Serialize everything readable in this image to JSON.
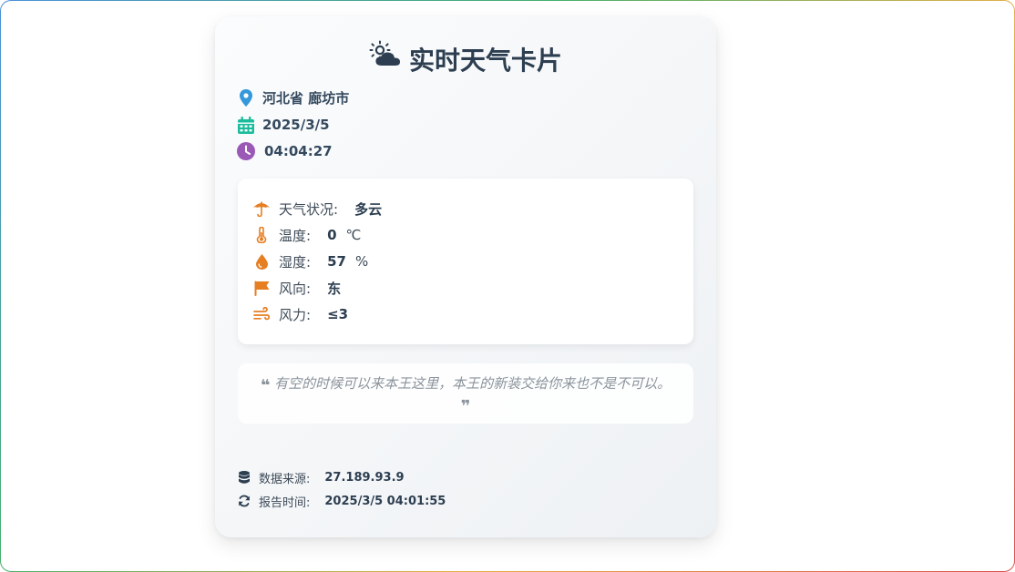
{
  "card": {
    "title": "实时天气卡片",
    "title_icon": "cloud-sun-icon"
  },
  "meta": {
    "location": "河北省 廊坊市",
    "date": "2025/3/5",
    "time": "04:04:27"
  },
  "weather": {
    "condition_label": "天气状况:",
    "condition_value": "多云",
    "temp_label": "温度:",
    "temp_value": "0",
    "temp_unit": "℃",
    "humidity_label": "湿度:",
    "humidity_value": "57",
    "humidity_unit": "%",
    "wind_dir_label": "风向:",
    "wind_dir_value": "东",
    "wind_power_label": "风力:",
    "wind_power_value": "≤3"
  },
  "quote": {
    "text": "有空的时候可以来本王这里，本王的新装交给你来也不是不可以。"
  },
  "footer": {
    "source_label": "数据来源:",
    "source_value": "27.189.93.9",
    "report_label": "报告时间:",
    "report_value": "2025/3/5 04:01:55"
  },
  "colors": {
    "title": "#2c3e50",
    "location_icon": "#3498db",
    "date_icon": "#1abc9c",
    "time_icon": "#9b59b6",
    "weather_icon": "#e67e22",
    "quote": "#8a939c"
  },
  "icons": {
    "location": "map-pin-icon",
    "date": "calendar-icon",
    "time": "clock-icon",
    "condition": "umbrella-icon",
    "temperature": "thermometer-icon",
    "humidity": "droplet-icon",
    "wind_direction": "flag-icon",
    "wind_power": "wind-icon",
    "source": "database-icon",
    "report": "refresh-icon"
  }
}
